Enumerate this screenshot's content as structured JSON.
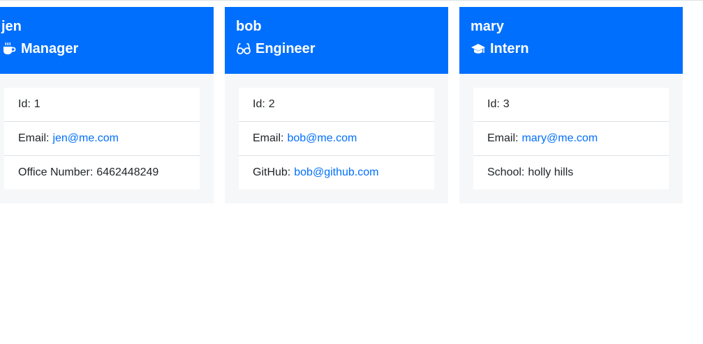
{
  "employees": [
    {
      "name": "jen",
      "role": "Manager",
      "role_icon": "mug-icon",
      "id_label": "Id:",
      "id": "1",
      "email_label": "Email:",
      "email": "jen@me.com",
      "extra_label": "Office Number:",
      "extra_value": "6462448249"
    },
    {
      "name": "bob",
      "role": "Engineer",
      "role_icon": "glasses-icon",
      "id_label": "Id:",
      "id": "2",
      "email_label": "Email:",
      "email": "bob@me.com",
      "extra_label": "GitHub:",
      "extra_value": "bob@github.com"
    },
    {
      "name": "mary",
      "role": "Intern",
      "role_icon": "graduation-cap-icon",
      "id_label": "Id:",
      "id": "3",
      "email_label": "Email:",
      "email": "mary@me.com",
      "extra_label": "School:",
      "extra_value": "holly hills"
    }
  ],
  "colors": {
    "header_bg": "#006ffd",
    "card_bg": "#f6f7f9",
    "link": "#006ffd"
  }
}
